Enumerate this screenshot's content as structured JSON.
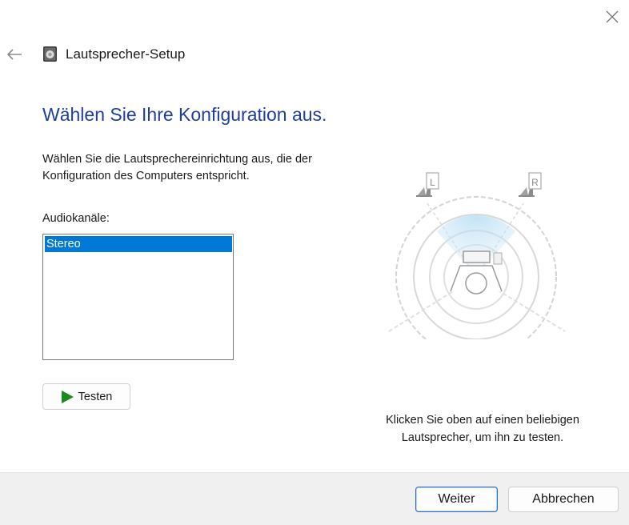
{
  "window": {
    "title": "Lautsprecher-Setup"
  },
  "page": {
    "heading": "Wählen Sie Ihre Konfiguration aus.",
    "description": "Wählen Sie die Lautsprechereinrichtung aus, die der Konfiguration des Computers entspricht.",
    "channels_label": "Audiokanäle:",
    "channels": [
      {
        "label": "Stereo",
        "selected": true
      }
    ],
    "test_button": "Testen",
    "hint": "Klicken Sie oben auf einen beliebigen Lautsprecher, um ihn zu testen.",
    "speakers": {
      "left": "L",
      "right": "R"
    }
  },
  "footer": {
    "next_button": "Weiter",
    "cancel_button": "Abbrechen"
  },
  "colors": {
    "heading": "#1f3f9e",
    "selection": "#0078d7",
    "play": "#1e8a1e",
    "footer_bg": "#f0f0f0"
  }
}
